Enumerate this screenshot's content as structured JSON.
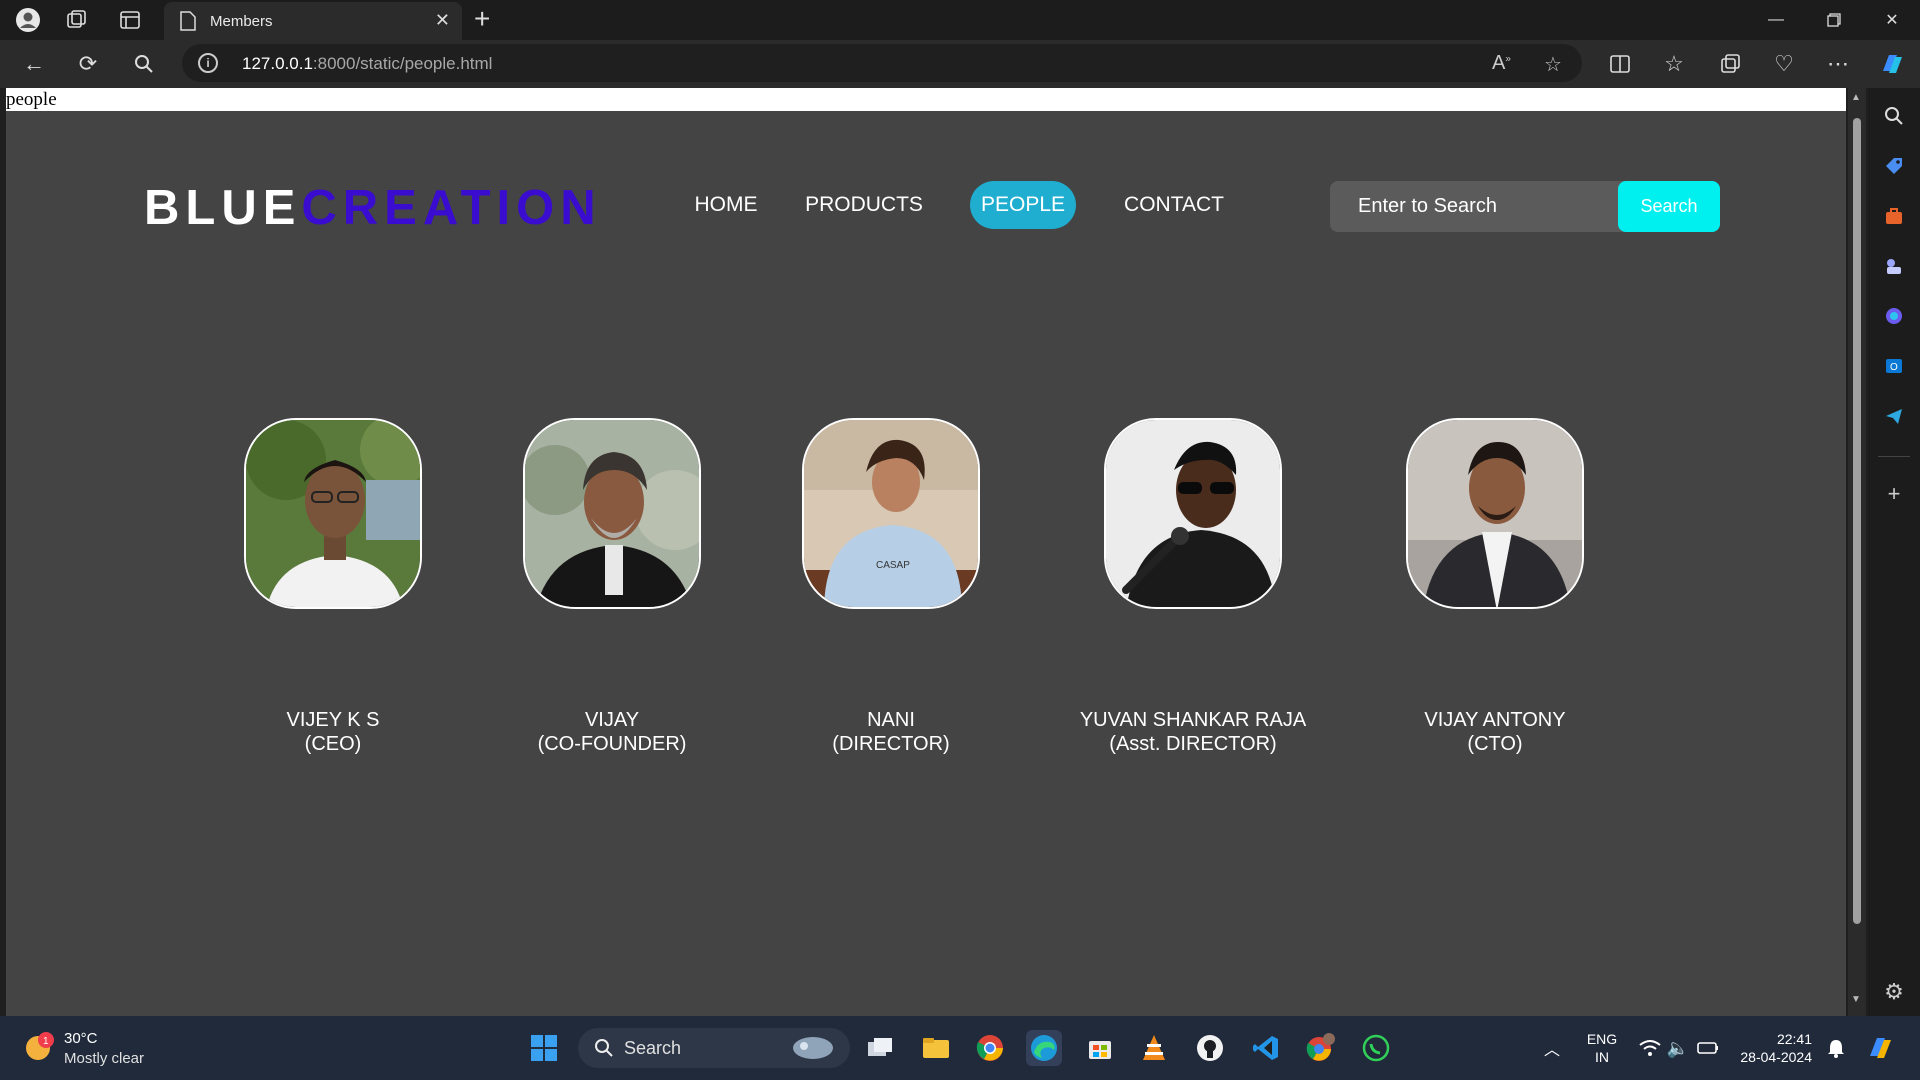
{
  "browser": {
    "tab_title": "Members",
    "url_host": "127.0.0.1",
    "url_rest": ":8000/static/people.html"
  },
  "page": {
    "doc_header": "people",
    "logo_blue": "BLUE",
    "logo_creation": "CREATION",
    "nav": {
      "home": "HOME",
      "products": "PRODUCTS",
      "people": "PEOPLE",
      "contact": "CONTACT"
    },
    "search": {
      "placeholder": "Enter to Search",
      "button": "Search"
    },
    "members": [
      {
        "name": "VIJEY K S",
        "role": "(CEO)"
      },
      {
        "name": "VIJAY",
        "role": "(CO-FOUNDER)"
      },
      {
        "name": "NANI",
        "role": "(DIRECTOR)"
      },
      {
        "name": "YUVAN SHANKAR RAJA",
        "role": "(Asst. DIRECTOR)"
      },
      {
        "name": "VIJAY ANTONY",
        "role": "(CTO)"
      }
    ],
    "colors": {
      "page_bg": "#444444",
      "logo_accent": "#3a0ccf",
      "active_nav": "#1faed0",
      "search_button": "#00f0f0"
    }
  },
  "taskbar": {
    "weather_temp": "30°C",
    "weather_condition": "Mostly clear",
    "weather_badge": "1",
    "search_label": "Search",
    "lang_top": "ENG",
    "lang_bottom": "IN",
    "time": "22:41",
    "date": "28-04-2024"
  }
}
